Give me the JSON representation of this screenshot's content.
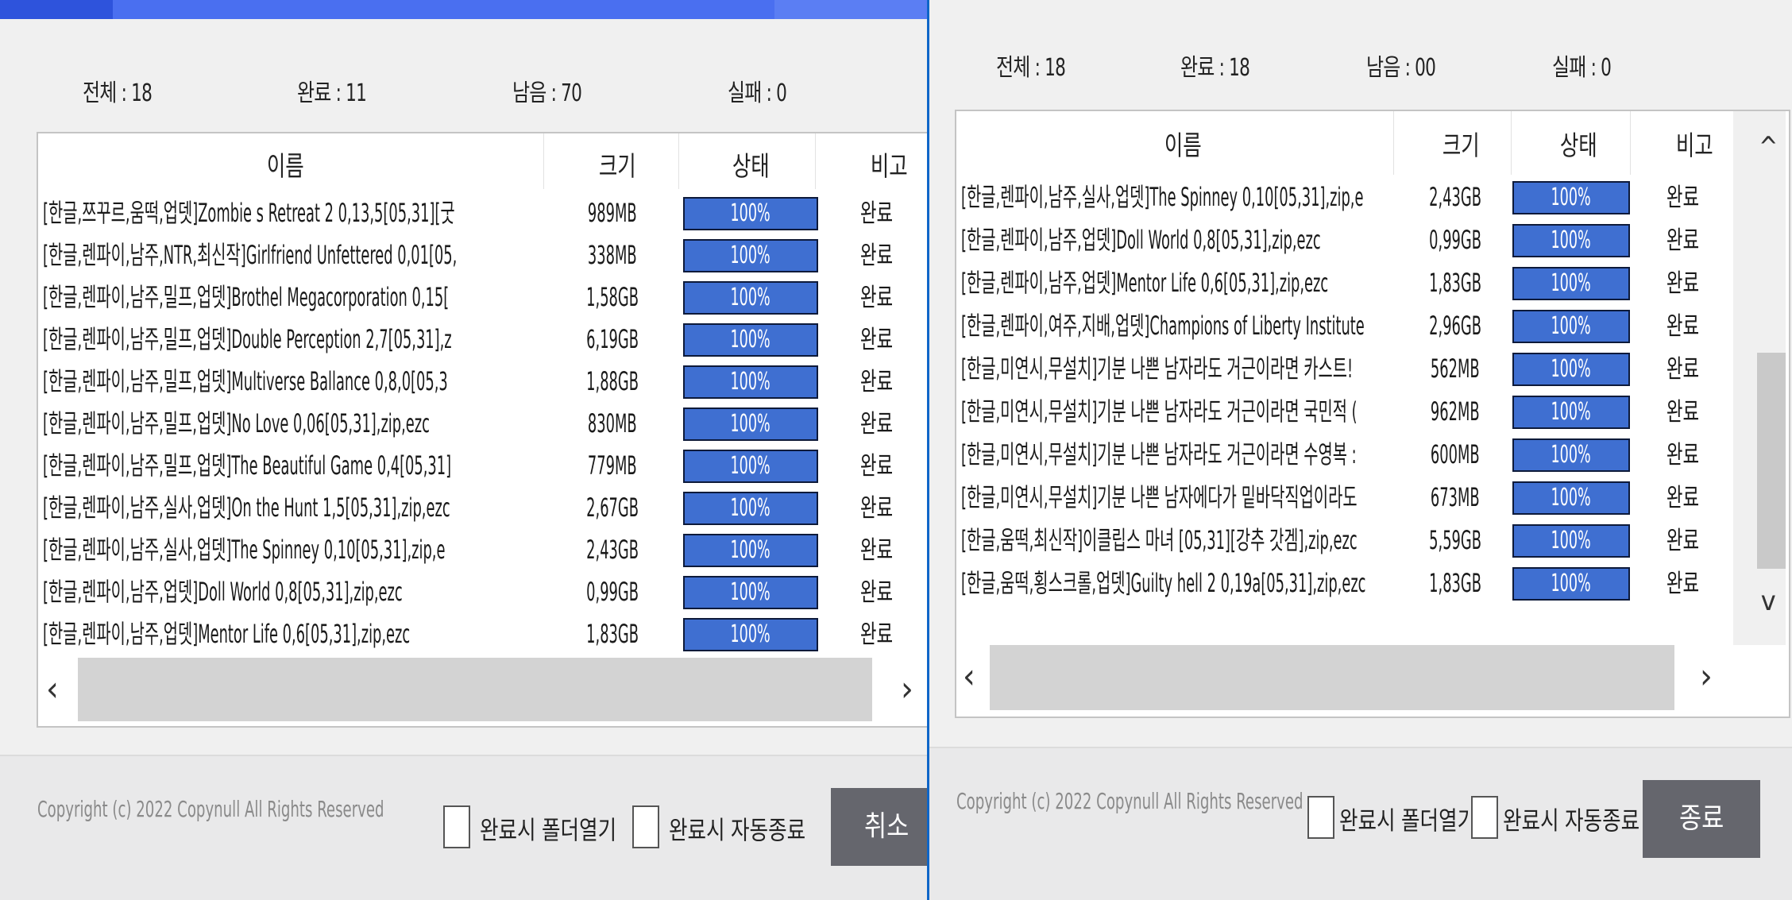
{
  "left": {
    "stats": {
      "total": "전체 : 18",
      "done": "완료 : 11",
      "remain": "남음 : 70",
      "fail": "실패 : 0"
    },
    "columns": {
      "name": "이름",
      "size": "크기",
      "status": "상태",
      "note": "비고"
    },
    "rows": [
      {
        "name": "[한글,쯔꾸르,움떡,업뎃]Zombie s Retreat 2 0,13,5[05,31][굿",
        "size": "989MB",
        "progress": "100%",
        "note": "완료"
      },
      {
        "name": "[한글,렌파이,남주,NTR,최신작]Girlfriend Unfettered 0,01[05,",
        "size": "338MB",
        "progress": "100%",
        "note": "완료"
      },
      {
        "name": "[한글,렌파이,남주,밀프,업뎃]Brothel Megacorporation 0,15[",
        "size": "1,58GB",
        "progress": "100%",
        "note": "완료"
      },
      {
        "name": "[한글,렌파이,남주,밀프,업뎃]Double Perception 2,7[05,31],z",
        "size": "6,19GB",
        "progress": "100%",
        "note": "완료"
      },
      {
        "name": "[한글,렌파이,남주,밀프,업뎃]Multiverse Ballance 0,8,0[05,3",
        "size": "1,88GB",
        "progress": "100%",
        "note": "완료"
      },
      {
        "name": "[한글,렌파이,남주,밀프,업뎃]No Love 0,06[05,31],zip,ezc",
        "size": "830MB",
        "progress": "100%",
        "note": "완료"
      },
      {
        "name": "[한글,렌파이,남주,밀프,업뎃]The Beautiful Game 0,4[05,31]",
        "size": "779MB",
        "progress": "100%",
        "note": "완료"
      },
      {
        "name": "[한글,렌파이,남주,실사,업뎃]On the Hunt 1,5[05,31],zip,ezc",
        "size": "2,67GB",
        "progress": "100%",
        "note": "완료"
      },
      {
        "name": "[한글,렌파이,남주,실사,업뎃]The Spinney 0,10[05,31],zip,e",
        "size": "2,43GB",
        "progress": "100%",
        "note": "완료"
      },
      {
        "name": "[한글,렌파이,남주,업뎃]Doll World 0,8[05,31],zip,ezc",
        "size": "0,99GB",
        "progress": "100%",
        "note": "완료"
      },
      {
        "name": "[한글,렌파이,남주,업뎃]Mentor Life 0,6[05,31],zip,ezc",
        "size": "1,83GB",
        "progress": "100%",
        "note": "완료"
      }
    ],
    "footer": {
      "copyright": "Copyright (c) 2022 Copynull All Rights Reserved",
      "open_folder": "완료시 폴더열기",
      "auto_close": "완료시 자동종료",
      "button": "취소"
    }
  },
  "right": {
    "stats": {
      "total": "전체 : 18",
      "done": "완료 : 18",
      "remain": "남음 : 00",
      "fail": "실패 : 0"
    },
    "columns": {
      "name": "이름",
      "size": "크기",
      "status": "상태",
      "note": "비고"
    },
    "rows": [
      {
        "name": "[한글,렌파이,남주,실사,업뎃]The Spinney 0,10[05,31],zip,e",
        "size": "2,43GB",
        "progress": "100%",
        "note": "완료"
      },
      {
        "name": "[한글,렌파이,남주,업뎃]Doll World 0,8[05,31],zip,ezc",
        "size": "0,99GB",
        "progress": "100%",
        "note": "완료"
      },
      {
        "name": "[한글,렌파이,남주,업뎃]Mentor Life 0,6[05,31],zip,ezc",
        "size": "1,83GB",
        "progress": "100%",
        "note": "완료"
      },
      {
        "name": "[한글,렌파이,여주,지배,업뎃]Champions of Liberty Institute",
        "size": "2,96GB",
        "progress": "100%",
        "note": "완료"
      },
      {
        "name": "[한글,미연시,무설치]기분 나쁜 남자라도 거근이라면 카스트!",
        "size": "562MB",
        "progress": "100%",
        "note": "완료"
      },
      {
        "name": "[한글,미연시,무설치]기분 나쁜 남자라도 거근이라면 국민적 (",
        "size": "962MB",
        "progress": "100%",
        "note": "완료"
      },
      {
        "name": "[한글,미연시,무설치]기분 나쁜 남자라도 거근이라면 수영복 :",
        "size": "600MB",
        "progress": "100%",
        "note": "완료"
      },
      {
        "name": "[한글,미연시,무설치]기분 나쁜 남자에다가 밑바닥직업이라도",
        "size": "673MB",
        "progress": "100%",
        "note": "완료"
      },
      {
        "name": "[한글,움떡,최신작]이클립스 마녀 [05,31][강추 갓겜],zip,ezc",
        "size": "5,59GB",
        "progress": "100%",
        "note": "완료"
      },
      {
        "name": "[한글,움떡,횡스크롤,업뎃]Guilty hell 2 0,19a[05,31],zip,ezc",
        "size": "1,83GB",
        "progress": "100%",
        "note": "완료"
      }
    ],
    "footer": {
      "copyright": "Copyright (c) 2022 Copynull All Rights Reserved",
      "open_folder": "완료시 폴더열기",
      "auto_close": "완료시 자동종료",
      "button": "종료"
    }
  },
  "icons": {
    "scroll_left": "‹",
    "scroll_right": "›",
    "scroll_up": "^",
    "scroll_down": "v"
  }
}
